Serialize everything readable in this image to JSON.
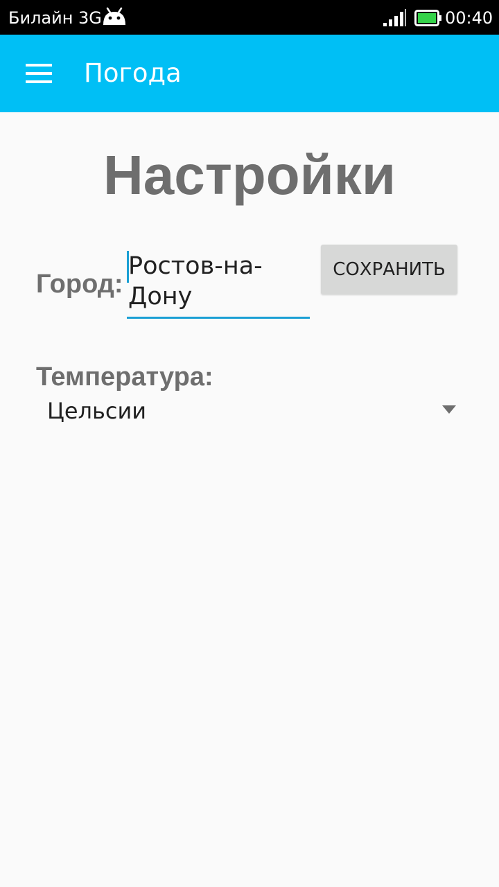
{
  "status_bar": {
    "carrier": "Билайн 3G",
    "time": "00:40",
    "icons": [
      "android-icon",
      "signal-icon",
      "battery-icon"
    ],
    "battery_color": "#35d34a"
  },
  "app_bar": {
    "title": "Погода",
    "menu_icon": "menu-icon",
    "color": "#00bff5"
  },
  "settings": {
    "title": "Настройки",
    "city": {
      "label": "Город:",
      "value": "Ростов-на-Дону"
    },
    "save_label": "СОХРАНИТЬ",
    "temperature": {
      "label": "Температура:",
      "selected": "Цельсии"
    }
  }
}
